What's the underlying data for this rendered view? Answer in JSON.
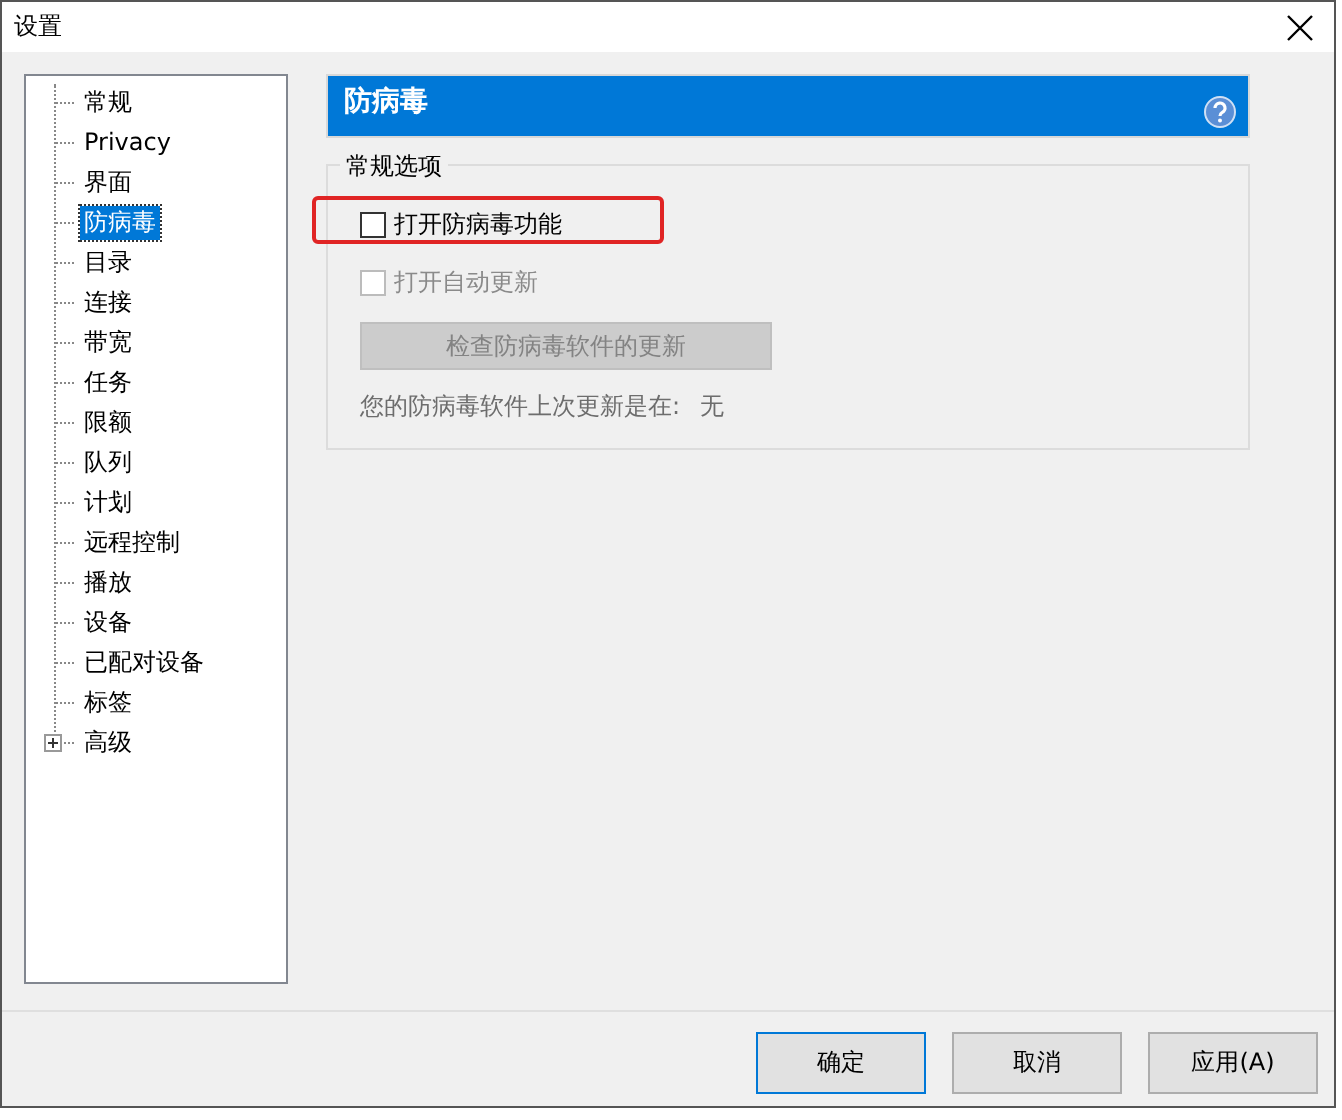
{
  "window": {
    "title": "设置"
  },
  "tree": {
    "items": [
      {
        "label": "常规",
        "selected": false
      },
      {
        "label": "Privacy",
        "selected": false
      },
      {
        "label": "界面",
        "selected": false
      },
      {
        "label": "防病毒",
        "selected": true
      },
      {
        "label": "目录",
        "selected": false
      },
      {
        "label": "连接",
        "selected": false
      },
      {
        "label": "带宽",
        "selected": false
      },
      {
        "label": "任务",
        "selected": false
      },
      {
        "label": "限额",
        "selected": false
      },
      {
        "label": "队列",
        "selected": false
      },
      {
        "label": "计划",
        "selected": false
      },
      {
        "label": "远程控制",
        "selected": false
      },
      {
        "label": "播放",
        "selected": false
      },
      {
        "label": "设备",
        "selected": false
      },
      {
        "label": "已配对设备",
        "selected": false
      },
      {
        "label": "标签",
        "selected": false
      },
      {
        "label": "高级",
        "selected": false,
        "expanded": false
      }
    ]
  },
  "panel": {
    "title": "防病毒",
    "group": {
      "title": "常规选项",
      "options": [
        {
          "label": "打开防病毒功能",
          "checked": false,
          "disabled": false,
          "highlighted": true
        },
        {
          "label": "打开自动更新",
          "checked": false,
          "disabled": true,
          "highlighted": false
        }
      ],
      "button": {
        "label": "检查防病毒软件的更新",
        "disabled": true
      },
      "last_update": {
        "label": "您的防病毒软件上次更新是在:",
        "value": "无"
      }
    }
  },
  "buttons": [
    {
      "label": "确定",
      "default": true
    },
    {
      "label": "取消",
      "default": false
    },
    {
      "label": "应用(A)",
      "default": false
    }
  ]
}
